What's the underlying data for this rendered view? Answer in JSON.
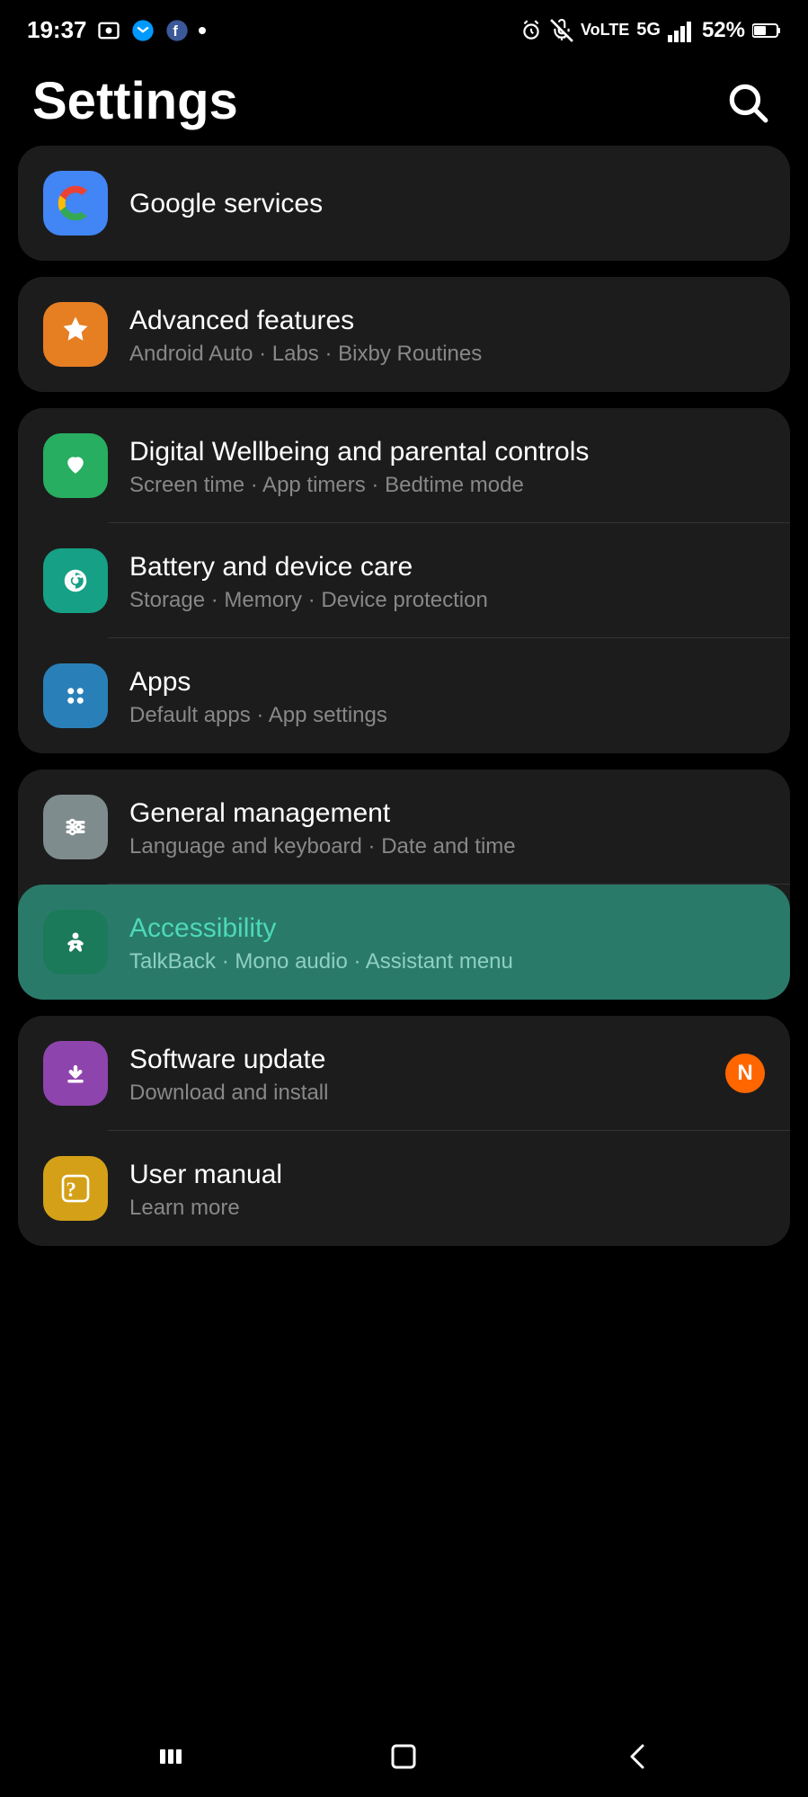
{
  "statusBar": {
    "time": "19:37",
    "battery": "52%",
    "icons": [
      "photo",
      "messenger",
      "facebook",
      "dot",
      "alarm",
      "mute",
      "volte",
      "5g",
      "signal",
      "battery"
    ]
  },
  "header": {
    "title": "Settings",
    "searchAriaLabel": "Search"
  },
  "settingGroups": [
    {
      "id": "google-group",
      "items": [
        {
          "id": "google-services",
          "icon": "google-icon",
          "iconBg": "#4285f4",
          "title": "Google services",
          "subtitle": "",
          "highlighted": false,
          "badge": null
        }
      ]
    },
    {
      "id": "advanced-group",
      "items": [
        {
          "id": "advanced-features",
          "icon": "advanced-icon",
          "iconBg": "#e67e22",
          "title": "Advanced features",
          "subtitle": "Android Auto · Labs · Bixby Routines",
          "highlighted": false,
          "badge": null
        }
      ]
    },
    {
      "id": "digital-battery-apps-group",
      "items": [
        {
          "id": "digital-wellbeing",
          "icon": "digital-wellbeing-icon",
          "iconBg": "#27ae60",
          "title": "Digital Wellbeing and parental controls",
          "subtitle": "Screen time · App timers · Bedtime mode",
          "highlighted": false,
          "badge": null
        },
        {
          "id": "battery-device-care",
          "icon": "battery-icon",
          "iconBg": "#16a085",
          "title": "Battery and device care",
          "subtitle": "Storage · Memory · Device protection",
          "highlighted": false,
          "badge": null
        },
        {
          "id": "apps",
          "icon": "apps-icon",
          "iconBg": "#2980b9",
          "title": "Apps",
          "subtitle": "Default apps · App settings",
          "highlighted": false,
          "badge": null
        }
      ]
    },
    {
      "id": "general-accessibility-group",
      "items": [
        {
          "id": "general-management",
          "icon": "general-icon",
          "iconBg": "#7f8c8d",
          "title": "General management",
          "subtitle": "Language and keyboard · Date and time",
          "highlighted": false,
          "badge": null
        },
        {
          "id": "accessibility",
          "icon": "accessibility-icon",
          "iconBg": "#1a7a5a",
          "title": "Accessibility",
          "subtitle": "TalkBack · Mono audio · Assistant menu",
          "highlighted": true,
          "badge": null
        }
      ]
    },
    {
      "id": "software-manual-group",
      "items": [
        {
          "id": "software-update",
          "icon": "software-icon",
          "iconBg": "#8e44ad",
          "title": "Software update",
          "subtitle": "Download and install",
          "highlighted": false,
          "badge": "N"
        },
        {
          "id": "user-manual",
          "icon": "manual-icon",
          "iconBg": "#d4a017",
          "title": "User manual",
          "subtitle": "Learn more",
          "highlighted": false,
          "badge": null
        }
      ]
    }
  ],
  "bottomNav": {
    "recentLabel": "Recent apps",
    "homeLabel": "Home",
    "backLabel": "Back"
  }
}
